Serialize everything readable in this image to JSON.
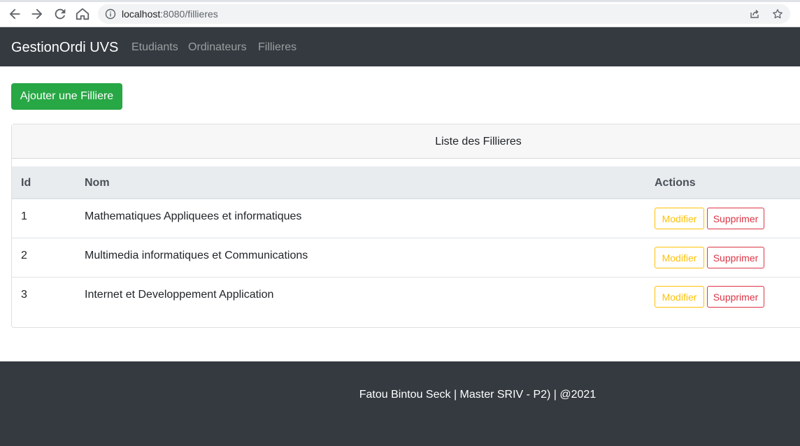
{
  "browser": {
    "url_host": "localhost",
    "url_port": ":8080",
    "url_path": "/fillieres"
  },
  "navbar": {
    "brand": "GestionOrdi UVS",
    "links": [
      "Etudiants",
      "Ordinateurs",
      "Fillieres"
    ]
  },
  "page": {
    "add_button_label": "Ajouter une Filliere",
    "card_title": "Liste des Fillieres",
    "columns": [
      "Id",
      "Nom",
      "Actions"
    ],
    "rows": [
      {
        "id": "1",
        "nom": "Mathematiques Appliquees et informatiques"
      },
      {
        "id": "2",
        "nom": "Multimedia informatiques et Communications"
      },
      {
        "id": "3",
        "nom": "Internet et Developpement Application"
      }
    ],
    "edit_label": "Modifier",
    "delete_label": "Supprimer"
  },
  "footer": {
    "text": "Fatou Bintou Seck | Master SRIV - P2) | @2021"
  },
  "colors": {
    "navbar_bg": "#343a40",
    "success": "#28a745",
    "warning": "#ffc107",
    "danger": "#dc3545"
  },
  "icons": [
    "back-arrow-icon",
    "forward-arrow-icon",
    "reload-icon",
    "home-icon",
    "info-icon",
    "share-icon",
    "star-icon"
  ]
}
